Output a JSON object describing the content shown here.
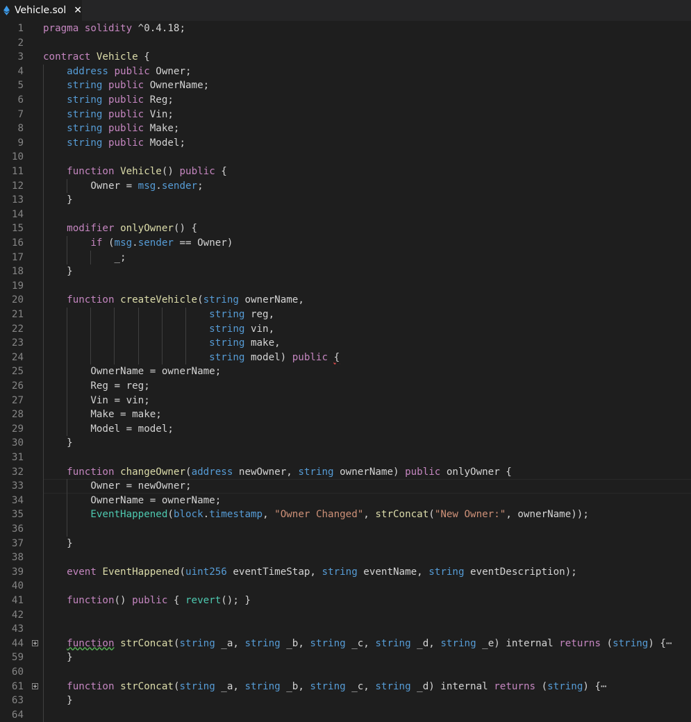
{
  "tab": {
    "label": "Vehicle.sol",
    "close_glyph": "✕",
    "icon": "ethereum-icon"
  },
  "colors": {
    "keyword": "#c586c0",
    "type": "#569cd6",
    "function": "#dcdcaa",
    "string": "#ce9178",
    "member": "#4ec9b0",
    "text": "#d4d4d4"
  },
  "lines": [
    {
      "n": "1",
      "tokens": [
        [
          "k",
          "pragma"
        ],
        [
          "p",
          " "
        ],
        [
          "k",
          "solidity"
        ],
        [
          "p",
          " ^0.4.18;"
        ]
      ]
    },
    {
      "n": "2",
      "tokens": []
    },
    {
      "n": "3",
      "tokens": [
        [
          "k",
          "contract"
        ],
        [
          "p",
          " "
        ],
        [
          "f",
          "Vehicle"
        ],
        [
          "p",
          " {"
        ]
      ]
    },
    {
      "n": "4",
      "tokens": [
        [
          "p",
          "    "
        ],
        [
          "t",
          "address"
        ],
        [
          "p",
          " "
        ],
        [
          "k",
          "public"
        ],
        [
          "p",
          " Owner;"
        ]
      ]
    },
    {
      "n": "5",
      "tokens": [
        [
          "p",
          "    "
        ],
        [
          "t",
          "string"
        ],
        [
          "p",
          " "
        ],
        [
          "k",
          "public"
        ],
        [
          "p",
          " OwnerName;"
        ]
      ]
    },
    {
      "n": "6",
      "tokens": [
        [
          "p",
          "    "
        ],
        [
          "t",
          "string"
        ],
        [
          "p",
          " "
        ],
        [
          "k",
          "public"
        ],
        [
          "p",
          " Reg;"
        ]
      ]
    },
    {
      "n": "7",
      "tokens": [
        [
          "p",
          "    "
        ],
        [
          "t",
          "string"
        ],
        [
          "p",
          " "
        ],
        [
          "k",
          "public"
        ],
        [
          "p",
          " Vin;"
        ]
      ]
    },
    {
      "n": "8",
      "tokens": [
        [
          "p",
          "    "
        ],
        [
          "t",
          "string"
        ],
        [
          "p",
          " "
        ],
        [
          "k",
          "public"
        ],
        [
          "p",
          " Make;"
        ]
      ]
    },
    {
      "n": "9",
      "tokens": [
        [
          "p",
          "    "
        ],
        [
          "t",
          "string"
        ],
        [
          "p",
          " "
        ],
        [
          "k",
          "public"
        ],
        [
          "p",
          " Model;"
        ]
      ]
    },
    {
      "n": "10",
      "tokens": []
    },
    {
      "n": "11",
      "tokens": [
        [
          "p",
          "    "
        ],
        [
          "k",
          "function"
        ],
        [
          "p",
          " "
        ],
        [
          "f",
          "Vehicle"
        ],
        [
          "p",
          "() "
        ],
        [
          "k",
          "public"
        ],
        [
          "p",
          " {"
        ]
      ]
    },
    {
      "n": "12",
      "tokens": [
        [
          "p",
          "        Owner = "
        ],
        [
          "t",
          "msg"
        ],
        [
          "p",
          "."
        ],
        [
          "t",
          "sender"
        ],
        [
          "p",
          ";"
        ]
      ]
    },
    {
      "n": "13",
      "tokens": [
        [
          "p",
          "    }"
        ]
      ]
    },
    {
      "n": "14",
      "tokens": []
    },
    {
      "n": "15",
      "tokens": [
        [
          "p",
          "    "
        ],
        [
          "k",
          "modifier"
        ],
        [
          "p",
          " "
        ],
        [
          "f",
          "onlyOwner"
        ],
        [
          "p",
          "() {"
        ]
      ]
    },
    {
      "n": "16",
      "tokens": [
        [
          "p",
          "        "
        ],
        [
          "k",
          "if"
        ],
        [
          "p",
          " ("
        ],
        [
          "t",
          "msg"
        ],
        [
          "p",
          "."
        ],
        [
          "t",
          "sender"
        ],
        [
          "p",
          " == Owner)"
        ]
      ]
    },
    {
      "n": "17",
      "tokens": [
        [
          "p",
          "            _;"
        ]
      ]
    },
    {
      "n": "18",
      "tokens": [
        [
          "p",
          "    }"
        ]
      ]
    },
    {
      "n": "19",
      "tokens": []
    },
    {
      "n": "20",
      "tokens": [
        [
          "p",
          "    "
        ],
        [
          "k",
          "function"
        ],
        [
          "p",
          " "
        ],
        [
          "f",
          "createVehicle"
        ],
        [
          "p",
          "("
        ],
        [
          "t",
          "string"
        ],
        [
          "p",
          " ownerName,"
        ]
      ]
    },
    {
      "n": "21",
      "tokens": [
        [
          "p",
          "                            "
        ],
        [
          "t",
          "string"
        ],
        [
          "p",
          " reg,"
        ]
      ]
    },
    {
      "n": "22",
      "tokens": [
        [
          "p",
          "                            "
        ],
        [
          "t",
          "string"
        ],
        [
          "p",
          " vin,"
        ]
      ]
    },
    {
      "n": "23",
      "tokens": [
        [
          "p",
          "                            "
        ],
        [
          "t",
          "string"
        ],
        [
          "p",
          " make,"
        ]
      ]
    },
    {
      "n": "24",
      "tokens": [
        [
          "p",
          "                            "
        ],
        [
          "t",
          "string"
        ],
        [
          "p",
          " model) "
        ],
        [
          "k",
          "public"
        ],
        [
          "p",
          " "
        ],
        [
          "p-sq-red",
          "{"
        ]
      ]
    },
    {
      "n": "25",
      "tokens": [
        [
          "p",
          "        OwnerName = ownerName;"
        ]
      ]
    },
    {
      "n": "26",
      "tokens": [
        [
          "p",
          "        Reg = reg;"
        ]
      ]
    },
    {
      "n": "27",
      "tokens": [
        [
          "p",
          "        Vin = vin;"
        ]
      ]
    },
    {
      "n": "28",
      "tokens": [
        [
          "p",
          "        Make = make;"
        ]
      ]
    },
    {
      "n": "29",
      "tokens": [
        [
          "p",
          "        Model = model;"
        ]
      ]
    },
    {
      "n": "30",
      "tokens": [
        [
          "p",
          "    }"
        ]
      ]
    },
    {
      "n": "31",
      "tokens": []
    },
    {
      "n": "32",
      "tokens": [
        [
          "p",
          "    "
        ],
        [
          "k",
          "function"
        ],
        [
          "p",
          " "
        ],
        [
          "f",
          "changeOwner"
        ],
        [
          "p",
          "("
        ],
        [
          "t",
          "address"
        ],
        [
          "p",
          " newOwner, "
        ],
        [
          "t",
          "string"
        ],
        [
          "p",
          " ownerName) "
        ],
        [
          "k",
          "public"
        ],
        [
          "p",
          " onlyOwner {"
        ]
      ]
    },
    {
      "n": "33",
      "tokens": [
        [
          "p",
          "        Owner = newOwner;"
        ]
      ],
      "current": true
    },
    {
      "n": "34",
      "tokens": [
        [
          "p",
          "        OwnerName = ownerName;"
        ]
      ]
    },
    {
      "n": "35",
      "tokens": [
        [
          "p",
          "        "
        ],
        [
          "m",
          "EventHappened"
        ],
        [
          "p",
          "("
        ],
        [
          "t",
          "block"
        ],
        [
          "p",
          "."
        ],
        [
          "t",
          "timestamp"
        ],
        [
          "p",
          ", "
        ],
        [
          "s",
          "\"Owner Changed\""
        ],
        [
          "p",
          ", "
        ],
        [
          "f",
          "strConcat"
        ],
        [
          "p",
          "("
        ],
        [
          "s",
          "\"New Owner:\""
        ],
        [
          "p",
          ", ownerName));"
        ]
      ]
    },
    {
      "n": "36",
      "tokens": []
    },
    {
      "n": "37",
      "tokens": [
        [
          "p",
          "    }"
        ]
      ]
    },
    {
      "n": "38",
      "tokens": []
    },
    {
      "n": "39",
      "tokens": [
        [
          "p",
          "    "
        ],
        [
          "k",
          "event"
        ],
        [
          "p",
          " "
        ],
        [
          "f",
          "EventHappened"
        ],
        [
          "p",
          "("
        ],
        [
          "t",
          "uint256"
        ],
        [
          "p",
          " eventTimeStap, "
        ],
        [
          "t",
          "string"
        ],
        [
          "p",
          " eventName, "
        ],
        [
          "t",
          "string"
        ],
        [
          "p",
          " eventDescription);"
        ]
      ]
    },
    {
      "n": "40",
      "tokens": []
    },
    {
      "n": "41",
      "tokens": [
        [
          "p",
          "    "
        ],
        [
          "k",
          "function"
        ],
        [
          "p",
          "() "
        ],
        [
          "k",
          "public"
        ],
        [
          "p",
          " { "
        ],
        [
          "m",
          "revert"
        ],
        [
          "p",
          "(); }"
        ]
      ]
    },
    {
      "n": "42",
      "tokens": []
    },
    {
      "n": "43",
      "tokens": []
    },
    {
      "n": "44",
      "tokens": [
        [
          "p",
          "    "
        ],
        [
          "k-sq-green",
          "function"
        ],
        [
          "p",
          " "
        ],
        [
          "f",
          "strConcat"
        ],
        [
          "p",
          "("
        ],
        [
          "t",
          "string"
        ],
        [
          "p",
          " _a, "
        ],
        [
          "t",
          "string"
        ],
        [
          "p",
          " _b, "
        ],
        [
          "t",
          "string"
        ],
        [
          "p",
          " _c, "
        ],
        [
          "t",
          "string"
        ],
        [
          "p",
          " _d, "
        ],
        [
          "t",
          "string"
        ],
        [
          "p",
          " _e) internal "
        ],
        [
          "k",
          "returns"
        ],
        [
          "p",
          " ("
        ],
        [
          "t",
          "string"
        ],
        [
          "p",
          ") {"
        ],
        [
          "fade",
          "⋯"
        ]
      ],
      "fold": true
    },
    {
      "n": "59",
      "tokens": [
        [
          "p",
          "    }"
        ]
      ]
    },
    {
      "n": "60",
      "tokens": []
    },
    {
      "n": "61",
      "tokens": [
        [
          "p",
          "    "
        ],
        [
          "k",
          "function"
        ],
        [
          "p",
          " "
        ],
        [
          "f",
          "strConcat"
        ],
        [
          "p",
          "("
        ],
        [
          "t",
          "string"
        ],
        [
          "p",
          " _a, "
        ],
        [
          "t",
          "string"
        ],
        [
          "p",
          " _b, "
        ],
        [
          "t",
          "string"
        ],
        [
          "p",
          " _c, "
        ],
        [
          "t",
          "string"
        ],
        [
          "p",
          " _d) internal "
        ],
        [
          "k",
          "returns"
        ],
        [
          "p",
          " ("
        ],
        [
          "t",
          "string"
        ],
        [
          "p",
          ") {"
        ],
        [
          "fade",
          "⋯"
        ]
      ],
      "fold": true
    },
    {
      "n": "63",
      "tokens": [
        [
          "p",
          "    }"
        ]
      ]
    },
    {
      "n": "64",
      "tokens": []
    }
  ]
}
